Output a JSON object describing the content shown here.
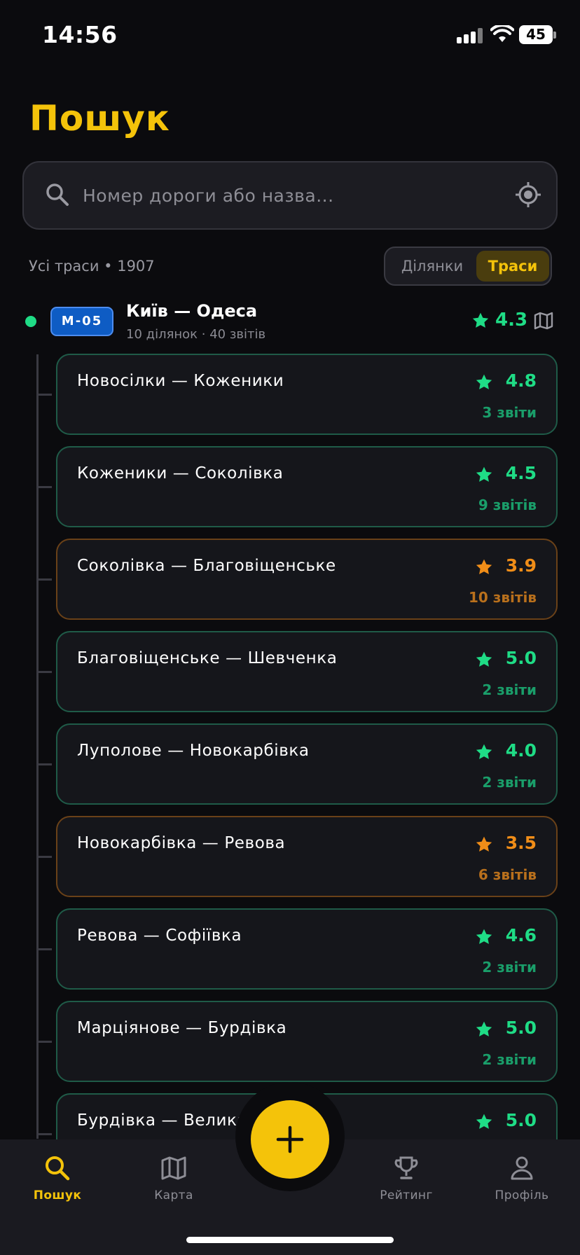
{
  "status_bar": {
    "time": "14:56",
    "battery": "45"
  },
  "page": {
    "title": "Пошук"
  },
  "search": {
    "placeholder": "Номер дороги або назва..."
  },
  "filter": {
    "summary": "Усі траси • 1907",
    "segments": [
      {
        "label": "Ділянки",
        "selected": false
      },
      {
        "label": "Траси",
        "selected": true
      }
    ]
  },
  "route": {
    "code": "М-05",
    "title": "Київ — Одеса",
    "subtitle": "10 ділянок · 40 звітів",
    "rating": "4.3",
    "status_color": "#1fdc86"
  },
  "sections": [
    {
      "name": "Новосілки — Коженики",
      "rating": "4.8",
      "reports": "3 звіти",
      "level": "good"
    },
    {
      "name": "Коженики — Соколівка",
      "rating": "4.5",
      "reports": "9 звітів",
      "level": "good"
    },
    {
      "name": "Соколівка — Благовіщенське",
      "rating": "3.9",
      "reports": "10 звітів",
      "level": "warn"
    },
    {
      "name": "Благовіщенське — Шевченка",
      "rating": "5.0",
      "reports": "2 звіти",
      "level": "good"
    },
    {
      "name": "Луполове — Новокарбівка",
      "rating": "4.0",
      "reports": "2 звіти",
      "level": "good"
    },
    {
      "name": "Новокарбівка — Ревова",
      "rating": "3.5",
      "reports": "6 звітів",
      "level": "warn"
    },
    {
      "name": "Ревова — Софіївка",
      "rating": "4.6",
      "reports": "2 звіти",
      "level": "good"
    },
    {
      "name": "Марціянове — Бурдівка",
      "rating": "5.0",
      "reports": "2 звіти",
      "level": "good"
    },
    {
      "name": "Бурдівка — Велика Б",
      "rating": "5.0",
      "reports": "",
      "level": "good"
    }
  ],
  "tabbar": {
    "search": "Пошук",
    "map": "Карта",
    "rating": "Рейтинг",
    "profile": "Профіль"
  },
  "colors": {
    "accent": "#f4c30a",
    "good": "#1fdc86",
    "warn": "#f08d18",
    "badge": "#0e5cc4"
  }
}
